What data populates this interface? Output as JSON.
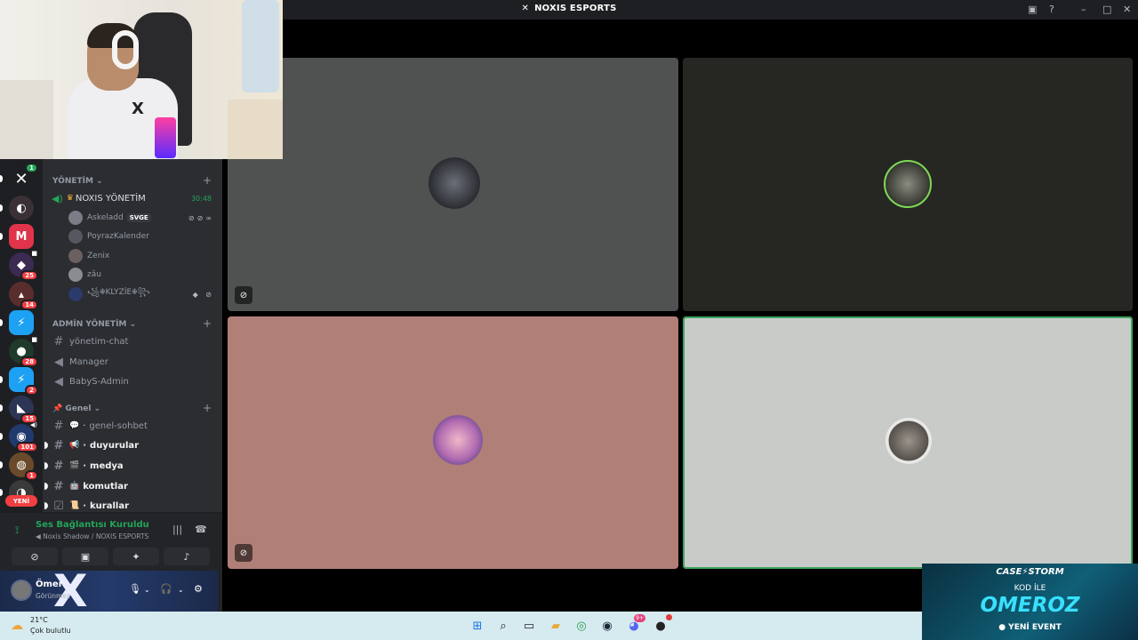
{
  "window": {
    "title": "NOXIS ESPORTS"
  },
  "rail": {
    "badges": [
      "25",
      "14",
      "28",
      "2",
      "15",
      "101",
      "1"
    ],
    "new_label": "YENİ",
    "home_badge": "1",
    "tile_letter": "M"
  },
  "sidebar": {
    "cat1": {
      "label": "YÖNETİM",
      "plus": "+"
    },
    "voice_channel": {
      "name": "NOXIS YÖNETİM",
      "timer": "30:48"
    },
    "members": [
      {
        "name": "Askeladd",
        "tag": "SVGE"
      },
      {
        "name": "PoyrazKalender"
      },
      {
        "name": "Zenix"
      },
      {
        "name": "zâu"
      },
      {
        "name": "꧁☬KLYZİE☬꧂"
      }
    ],
    "cat2": {
      "label": "ADMİN YÖNETİM",
      "plus": "+"
    },
    "admin_channels": [
      "yönetim-chat",
      "Manager",
      "BabyS-Admin"
    ],
    "cat3": {
      "label": "Genel",
      "plus": "+"
    },
    "general_channels": [
      "genel-sohbet",
      "duyurular",
      "medya",
      "komutlar",
      "kurallar"
    ]
  },
  "voice_panel": {
    "status": "Ses Bağlantısı Kuruldu",
    "sub": "Noxis Shadow / NOXIS ESPORTS"
  },
  "user_panel": {
    "name": "Ömer",
    "status": "Görünmez"
  },
  "stage": {
    "tiles": [
      {
        "bg": "#4f5251"
      },
      {
        "bg": "#262722"
      },
      {
        "bg": "#b07f77"
      },
      {
        "bg": "#c9cbc9",
        "speaking_border": "#3ba55d"
      }
    ]
  },
  "promo": {
    "brand": "CASE⚡STORM",
    "kod": "KOD İLE",
    "code": "OMEROZ",
    "event": "● YENİ EVENT"
  },
  "taskbar": {
    "temp": "21°C",
    "cond": "Çok bulutlu",
    "discord_badge": "9+"
  },
  "colors": {
    "accent_green": "#23a55a",
    "badge_red": "#f23f43",
    "sidebar": "#2b2d31",
    "rail": "#1e1f22"
  }
}
